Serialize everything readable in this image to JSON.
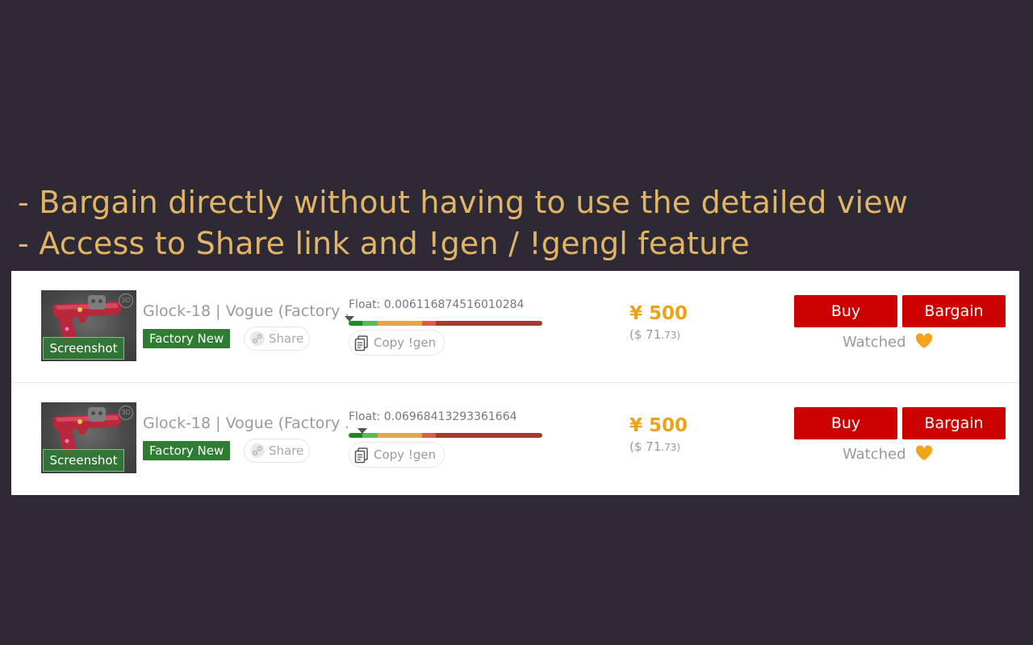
{
  "caption": {
    "line1": "- Bargain directly without having to use the detailed view",
    "line2": "- Access to Share link and !gen / !gengl feature"
  },
  "colors": {
    "background": "#2d2a35",
    "caption": "#e2b466",
    "accent_red": "#cc0000",
    "price": "#eba31b",
    "wear_badge": "#2e7d32"
  },
  "float_bar_segments": [
    {
      "color": "#1e8a1e",
      "fraction": 0.07
    },
    {
      "color": "#5cb85c",
      "fraction": 0.08
    },
    {
      "color": "#e3a844",
      "fraction": 0.23
    },
    {
      "color": "#e05a4a",
      "fraction": 0.07
    },
    {
      "color": "#a53a33",
      "fraction": 0.55
    }
  ],
  "listings": [
    {
      "screenshot_label": "Screenshot",
      "name": "Glock-18 | Vogue (Factory ...",
      "wear": "Factory New",
      "share_label": "Share",
      "float_text": "Float: 0.006116874516010284",
      "float_value": 0.006116874516010284,
      "copy_label": "Copy !gen",
      "price": "¥ 500",
      "usd_main": "($ 71",
      "usd_cents": ".73)",
      "buy_label": "Buy",
      "bargain_label": "Bargain",
      "watched_label": "Watched",
      "icons": [
        "3d-icon",
        "robot-icon",
        "link-icon",
        "copy-icon",
        "heart-icon"
      ]
    },
    {
      "screenshot_label": "Screenshot",
      "name": "Glock-18 | Vogue (Factory ...",
      "wear": "Factory New",
      "share_label": "Share",
      "float_text": "Float: 0.06968413293361664",
      "float_value": 0.06968413293361664,
      "copy_label": "Copy !gen",
      "price": "¥ 500",
      "usd_main": "($ 71",
      "usd_cents": ".73)",
      "buy_label": "Buy",
      "bargain_label": "Bargain",
      "watched_label": "Watched",
      "icons": [
        "3d-icon",
        "robot-icon",
        "link-icon",
        "copy-icon",
        "heart-icon"
      ]
    }
  ]
}
